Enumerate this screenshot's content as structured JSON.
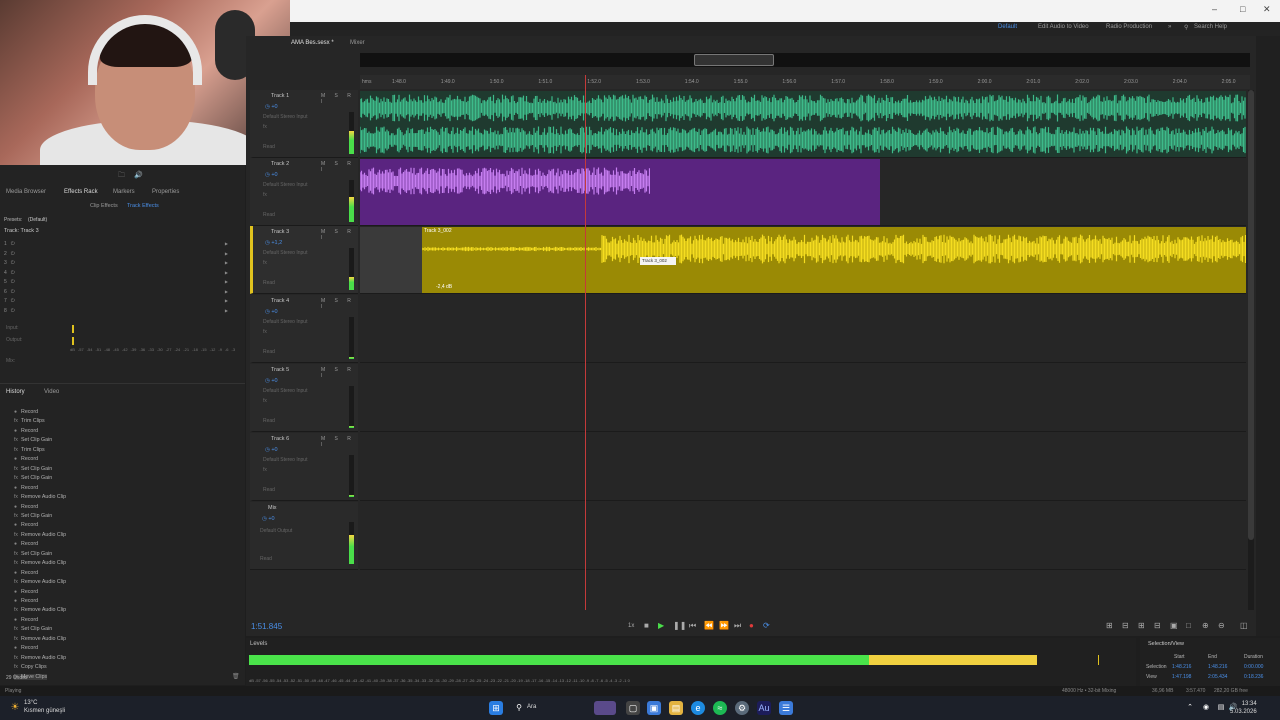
{
  "window": {
    "tab_session": "AMA Bes.sesx *",
    "tab_mixer": "Mixer",
    "workspaces": [
      "Default",
      "Edit Audio to Video",
      "Radio Production"
    ],
    "search_help": "Search Help"
  },
  "panels": {
    "tabs": [
      "Media Browser",
      "Effects Rack",
      "Markers",
      "Properties"
    ],
    "subtabs": [
      "Clip Effects",
      "Track Effects"
    ],
    "presets_label": "Presets:",
    "presets_value": "(Default)",
    "rack_title": "Track: Track 3",
    "rack_slots": [
      "1",
      "2",
      "3",
      "4",
      "5",
      "6",
      "7",
      "8"
    ],
    "input_label": "Input:",
    "output_label": "Output:",
    "mix_label": "Mix:",
    "mix_scale": [
      "dB",
      "-57",
      "-54",
      "-51",
      "-48",
      "-45",
      "-42",
      "-39",
      "-36",
      "-33",
      "-30",
      "-27",
      "-24",
      "-21",
      "-18",
      "-15",
      "-12",
      "-9",
      "-6",
      "-3",
      "0"
    ],
    "history_tabs": [
      "History",
      "Video"
    ],
    "history_items": [
      "Record",
      "Trim Clips",
      "Record",
      "Set Clip Gain",
      "Trim Clips",
      "Record",
      "Set Clip Gain",
      "Set Clip Gain",
      "Record",
      "Remove Audio Clip",
      "Record",
      "Set Clip Gain",
      "Record",
      "Remove Audio Clip",
      "Record",
      "Set Clip Gain",
      "Remove Audio Clip",
      "Record",
      "Remove Audio Clip",
      "Record",
      "Record",
      "Remove Audio Clip",
      "Record",
      "Set Clip Gain",
      "Remove Audio Clip",
      "Record",
      "Remove Audio Clip",
      "Copy Clips",
      "Move Clips"
    ],
    "undos": "29 Undos"
  },
  "ruler": {
    "unit": "hms",
    "ticks": [
      "1:48.0",
      "1:49.0",
      "1:50.0",
      "1:51.0",
      "1:52.0",
      "1:53.0",
      "1:54.0",
      "1:55.0",
      "1:56.0",
      "1:57.0",
      "1:58.0",
      "1:59.0",
      "2:00.0",
      "2:01.0",
      "2:02.0",
      "2:03.0",
      "2:04.0",
      "2:05.0"
    ]
  },
  "tracks": [
    {
      "name": "Track 1",
      "vol": "+0",
      "color": "#3dbb8a",
      "in": "Default Stereo Input",
      "meter": 0.55
    },
    {
      "name": "Track 2",
      "vol": "+0",
      "color": "#a44ad6",
      "in": "Default Stereo Input",
      "meter": 0.6
    },
    {
      "name": "Track 3",
      "vol": "+1,2",
      "color": "#e0c21e",
      "in": "Default Stereo Input",
      "meter": 0.3
    },
    {
      "name": "Track 4",
      "vol": "+0",
      "color": "#3dbb8a",
      "in": "Default Stereo Input",
      "meter": 0.05
    },
    {
      "name": "Track 5",
      "vol": "+0",
      "color": "#c23a8a",
      "in": "Default Stereo Input",
      "meter": 0.05
    },
    {
      "name": "Track 6",
      "vol": "+0",
      "color": "#4a9a3a",
      "in": "Default Stereo Input",
      "meter": 0.05
    }
  ],
  "mix_track": {
    "name": "Mix",
    "vol": "+0",
    "out": "Default Output",
    "meter": 0.7
  },
  "row_labels": {
    "read": "Read",
    "fx": "fx",
    "pan": "Pan"
  },
  "clips": {
    "track3_name": "Track 3_002",
    "track3_tooltip": "Track 3_002",
    "track3_gain": "-2,4 dB"
  },
  "transport": {
    "timecode": "1:51.845",
    "speed": "1x"
  },
  "levels": {
    "title": "Levels",
    "green_fraction": 0.7,
    "yellow_fraction": 0.19,
    "scale": "dB -57 -56 -55 -54 -53 -52 -51 -50 -49 -48 -47 -46 -45 -44 -43 -42 -41 -40 -39 -38 -37 -36 -35 -34 -33 -32 -31 -30 -29 -28 -27 -26 -25 -24 -23 -22 -21 -20 -19 -18 -17 -16 -15 -14 -13 -12 -11 -10 -9 -8 -7 -6 -5 -4 -3 -2 -1 0"
  },
  "selection_view": {
    "title": "Selection/View",
    "headers": [
      "Start",
      "End",
      "Duration"
    ],
    "rows": [
      {
        "label": "Selection",
        "start": "1:48.216",
        "end": "1:48.216",
        "duration": "0:00.000"
      },
      {
        "label": "View",
        "start": "1:47.198",
        "end": "2:05.434",
        "duration": "0:18.236"
      }
    ]
  },
  "statusbar": {
    "left": "Playing",
    "right1": "48000 Hz • 32-bit Mixing",
    "right2": "36,96 MB",
    "right3": "3:57.470",
    "right4": "282,20 GB free"
  },
  "taskbar": {
    "weather_temp": "13°C",
    "weather_desc": "Kısmen güneşli",
    "search": "Ara",
    "time": "13:34",
    "date": "5.03.2026"
  }
}
